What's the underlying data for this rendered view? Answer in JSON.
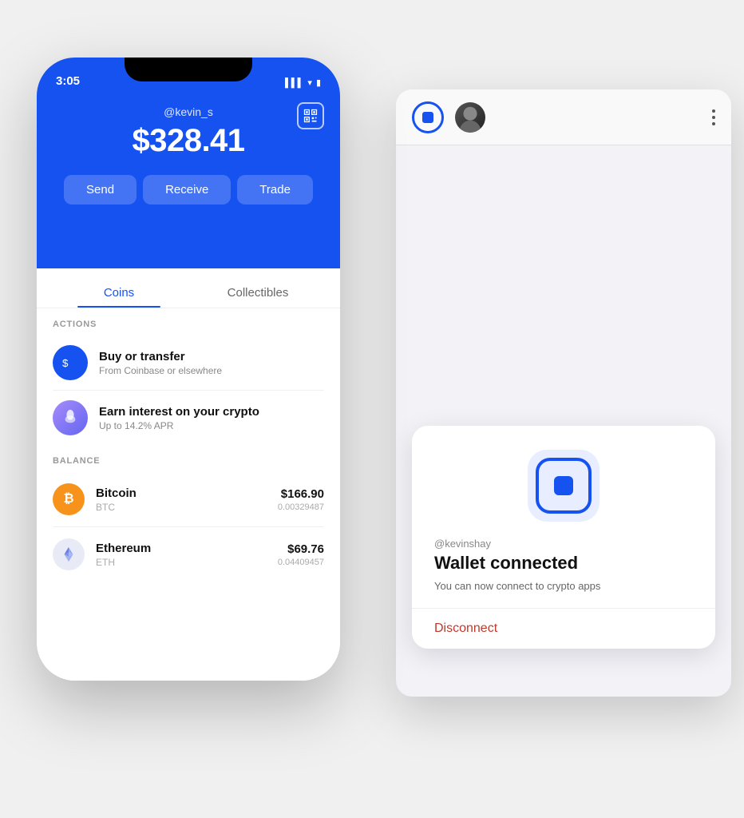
{
  "scene": {
    "background": "#f0f0f0"
  },
  "phone": {
    "status_time": "3:05",
    "username": "@kevin_s",
    "balance": "$328.41",
    "qr_label": "QR",
    "action_buttons": [
      {
        "label": "Send",
        "id": "send"
      },
      {
        "label": "Receive",
        "id": "receive"
      },
      {
        "label": "Trade",
        "id": "trade"
      }
    ],
    "tabs": [
      {
        "label": "Coins",
        "active": true
      },
      {
        "label": "Collectibles",
        "active": false
      }
    ],
    "actions_section_label": "ACTIONS",
    "actions": [
      {
        "title": "Buy or transfer",
        "subtitle": "From Coinbase or elsewhere",
        "icon_type": "dollar"
      },
      {
        "title": "Earn interest on your crypto",
        "subtitle": "Up to 14.2% APR",
        "icon_type": "earn"
      }
    ],
    "balance_section_label": "BALANCE",
    "coins": [
      {
        "name": "Bitcoin",
        "ticker": "BTC",
        "usd_value": "$166.90",
        "amount": "0.00329487",
        "icon_type": "btc"
      },
      {
        "name": "Ethereum",
        "ticker": "ETH",
        "usd_value": "$69.76",
        "amount": "0.04409457",
        "icon_type": "eth"
      }
    ]
  },
  "browser": {
    "header_visible": true
  },
  "wallet_card": {
    "username": "@kevinshay",
    "title": "Wallet connected",
    "subtitle": "You can now connect to crypto apps",
    "disconnect_label": "Disconnect"
  }
}
